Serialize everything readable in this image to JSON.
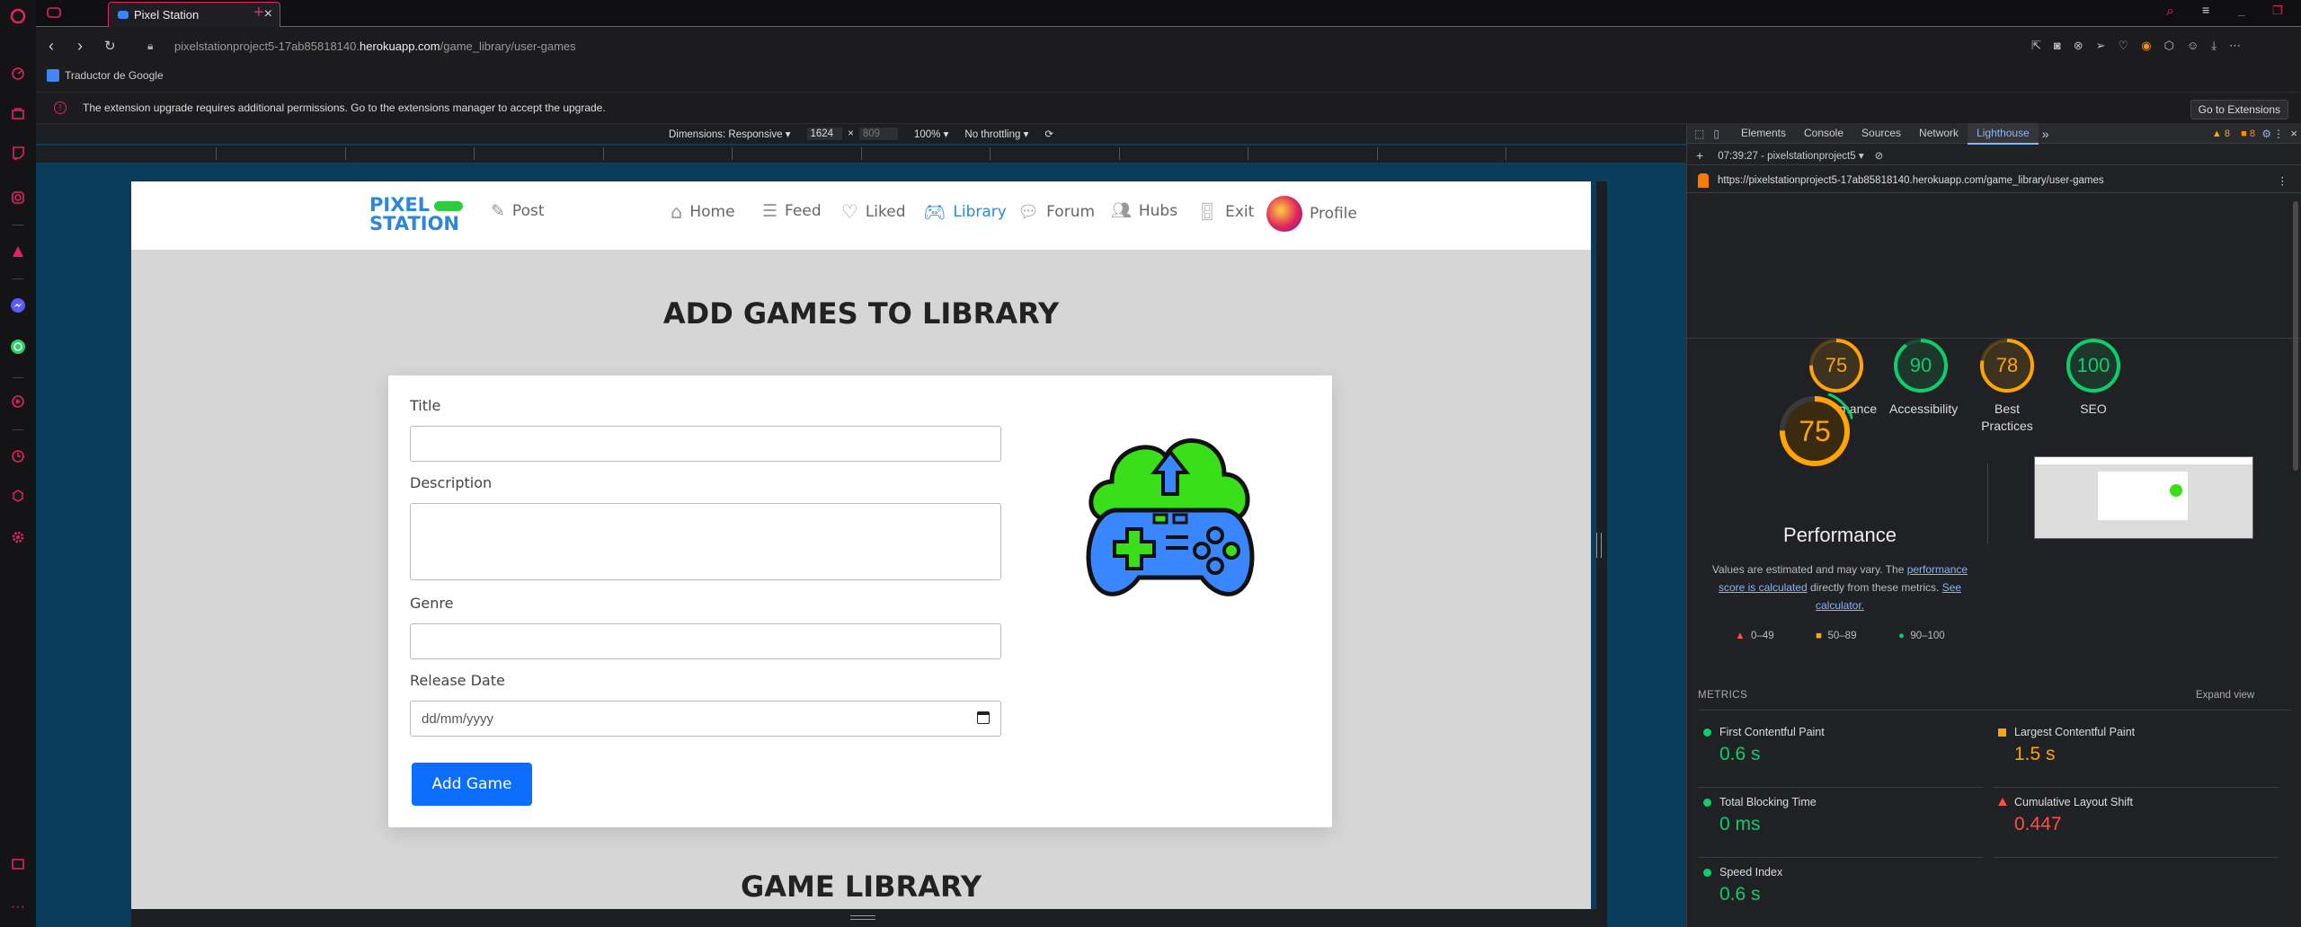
{
  "browser": {
    "tab_title": "Pixel Station",
    "url_prefix": "pixelstationproject5-17ab85818140.",
    "url_domain": "herokuapp.com",
    "url_path": "/game_library/user-games",
    "bookmark": "Traductor de Google",
    "info_message": "The extension upgrade requires additional permissions. Go to the extensions manager to accept the upgrade.",
    "info_button": "Go to Extensions"
  },
  "device_toolbar": {
    "dimensions": "Dimensions: Responsive",
    "width": "1624",
    "height": "809",
    "zoom": "100%",
    "throttling": "No throttling",
    "times": "×"
  },
  "site": {
    "logo_line1": "PIXEL",
    "logo_line2": "STATION",
    "nav": {
      "post": "Post",
      "home": "Home",
      "feed": "Feed",
      "liked": "Liked",
      "library": "Library",
      "forum": "Forum",
      "hubs": "Hubs",
      "exit": "Exit",
      "profile": "Profile"
    },
    "heading": "ADD GAMES TO LIBRARY",
    "form": {
      "title_label": "Title",
      "description_label": "Description",
      "genre_label": "Genre",
      "release_label": "Release Date",
      "date_placeholder": "dd/mm/yyyy",
      "submit": "Add Game"
    },
    "library_heading": "GAME LIBRARY"
  },
  "devtools": {
    "tabs": [
      "Elements",
      "Console",
      "Sources",
      "Network",
      "Lighthouse"
    ],
    "active_tab": "Lighthouse",
    "more": "»",
    "warnings": "8",
    "errors": "8",
    "report_selector": "07:39:27 - pixelstationproject5",
    "report_url": "https://pixelstationproject5-17ab85818140.herokuapp.com/game_library/user-games",
    "scores": [
      {
        "label": "Performance",
        "value": 75,
        "color": "#ffa400"
      },
      {
        "label": "Accessibility",
        "value": 90,
        "color": "#0cce6b"
      },
      {
        "label": "Best Practices",
        "value": 78,
        "color": "#ffa400"
      },
      {
        "label": "SEO",
        "value": 100,
        "color": "#0cce6b"
      }
    ],
    "big_score": "75",
    "big_label": "Performance",
    "note_pre": "Values are estimated and may vary. The ",
    "note_link1": "performance score is calculated",
    "note_mid": " directly from these metrics. ",
    "note_link2": "See calculator.",
    "legend": [
      "0–49",
      "50–89",
      "90–100"
    ],
    "metrics_title": "METRICS",
    "expand": "Expand view",
    "metrics": [
      {
        "name": "First Contentful Paint",
        "value": "0.6 s",
        "status": "good"
      },
      {
        "name": "Largest Contentful Paint",
        "value": "1.5 s",
        "status": "average"
      },
      {
        "name": "Total Blocking Time",
        "value": "0 ms",
        "status": "good"
      },
      {
        "name": "Cumulative Layout Shift",
        "value": "0.447",
        "status": "fail"
      },
      {
        "name": "Speed Index",
        "value": "0.6 s",
        "status": "good"
      }
    ]
  },
  "colors": {
    "good": "#0cce6b",
    "average": "#ffa400",
    "fail": "#ff4e42",
    "accent": "#e0245e",
    "primary_button": "#0d6efd"
  }
}
